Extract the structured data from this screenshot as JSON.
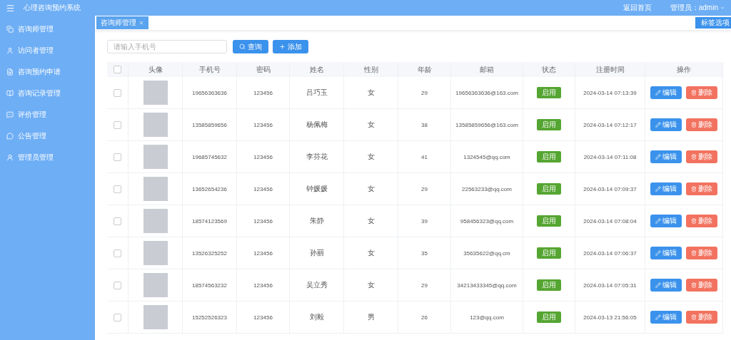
{
  "app": {
    "title": "心理咨询预约系统"
  },
  "header": {
    "home_link": "返回首页",
    "user": "管理员：admin"
  },
  "sidebar": {
    "items": [
      {
        "label": "咨询师管理"
      },
      {
        "label": "访问者管理"
      },
      {
        "label": "咨询预约申请"
      },
      {
        "label": "咨询记录管理"
      },
      {
        "label": "评价管理"
      },
      {
        "label": "公告管理"
      },
      {
        "label": "管理员管理"
      }
    ]
  },
  "tabs": [
    {
      "label": "咨询师管理",
      "selected": true
    }
  ],
  "tab_options": "标签选项",
  "search": {
    "placeholder": "请输入手机号"
  },
  "buttons": [
    {
      "kind": "search",
      "label": "查询"
    },
    {
      "kind": "add",
      "label": "添加"
    }
  ],
  "table": {
    "select_all": {
      "checked": false
    },
    "columns": [
      "头像",
      "手机号",
      "密码",
      "姓名",
      "性别",
      "年龄",
      "邮箱",
      "状态",
      "注册时间",
      "操作"
    ],
    "rows": [
      {
        "checked": false,
        "phone": "19656363636",
        "password": "123456",
        "name": "吕巧玉",
        "gender": "女",
        "age": "29",
        "email": "19656363636@163.com",
        "status": "启用",
        "registered": "2024-03-14 07:13:39",
        "actions": [
          "编辑",
          "删除"
        ]
      },
      {
        "checked": false,
        "phone": "13585859656",
        "password": "123456",
        "name": "杨佩梅",
        "gender": "女",
        "age": "38",
        "email": "13585859656@163.com",
        "status": "启用",
        "registered": "2024-03-14 07:12:17",
        "actions": [
          "编辑",
          "删除"
        ]
      },
      {
        "checked": false,
        "phone": "19685745632",
        "password": "123456",
        "name": "李芬花",
        "gender": "女",
        "age": "41",
        "email": "1324545@qq.com",
        "status": "启用",
        "registered": "2024-03-14 07:11:08",
        "actions": [
          "编辑",
          "删除"
        ]
      },
      {
        "checked": false,
        "phone": "13652654236",
        "password": "123456",
        "name": "钟媛媛",
        "gender": "女",
        "age": "29",
        "email": "22563233@qq.com",
        "status": "启用",
        "registered": "2024-03-14 07:09:37",
        "actions": [
          "编辑",
          "删除"
        ]
      },
      {
        "checked": false,
        "phone": "18574123569",
        "password": "123456",
        "name": "朱静",
        "gender": "女",
        "age": "39",
        "email": "958456323@qq.com",
        "status": "启用",
        "registered": "2024-03-14 07:08:04",
        "actions": [
          "编辑",
          "删除"
        ]
      },
      {
        "checked": false,
        "phone": "13526325252",
        "password": "123456",
        "name": "孙丽",
        "gender": "女",
        "age": "35",
        "email": "35635622@qq.cm",
        "status": "启用",
        "registered": "2024-03-14 07:06:37",
        "actions": [
          "编辑",
          "删除"
        ]
      },
      {
        "checked": false,
        "phone": "18574563232",
        "password": "123456",
        "name": "吴立秀",
        "gender": "女",
        "age": "29",
        "email": "34213433345@qq.com",
        "status": "启用",
        "registered": "2024-03-14 07:05:31",
        "actions": [
          "编辑",
          "删除"
        ]
      },
      {
        "checked": false,
        "phone": "15252526323",
        "password": "123456",
        "name": "刘毅",
        "gender": "男",
        "age": "26",
        "email": "123@qq.com",
        "status": "启用",
        "registered": "2024-03-13 21:56:05",
        "actions": [
          "编辑",
          "删除"
        ]
      }
    ]
  }
}
